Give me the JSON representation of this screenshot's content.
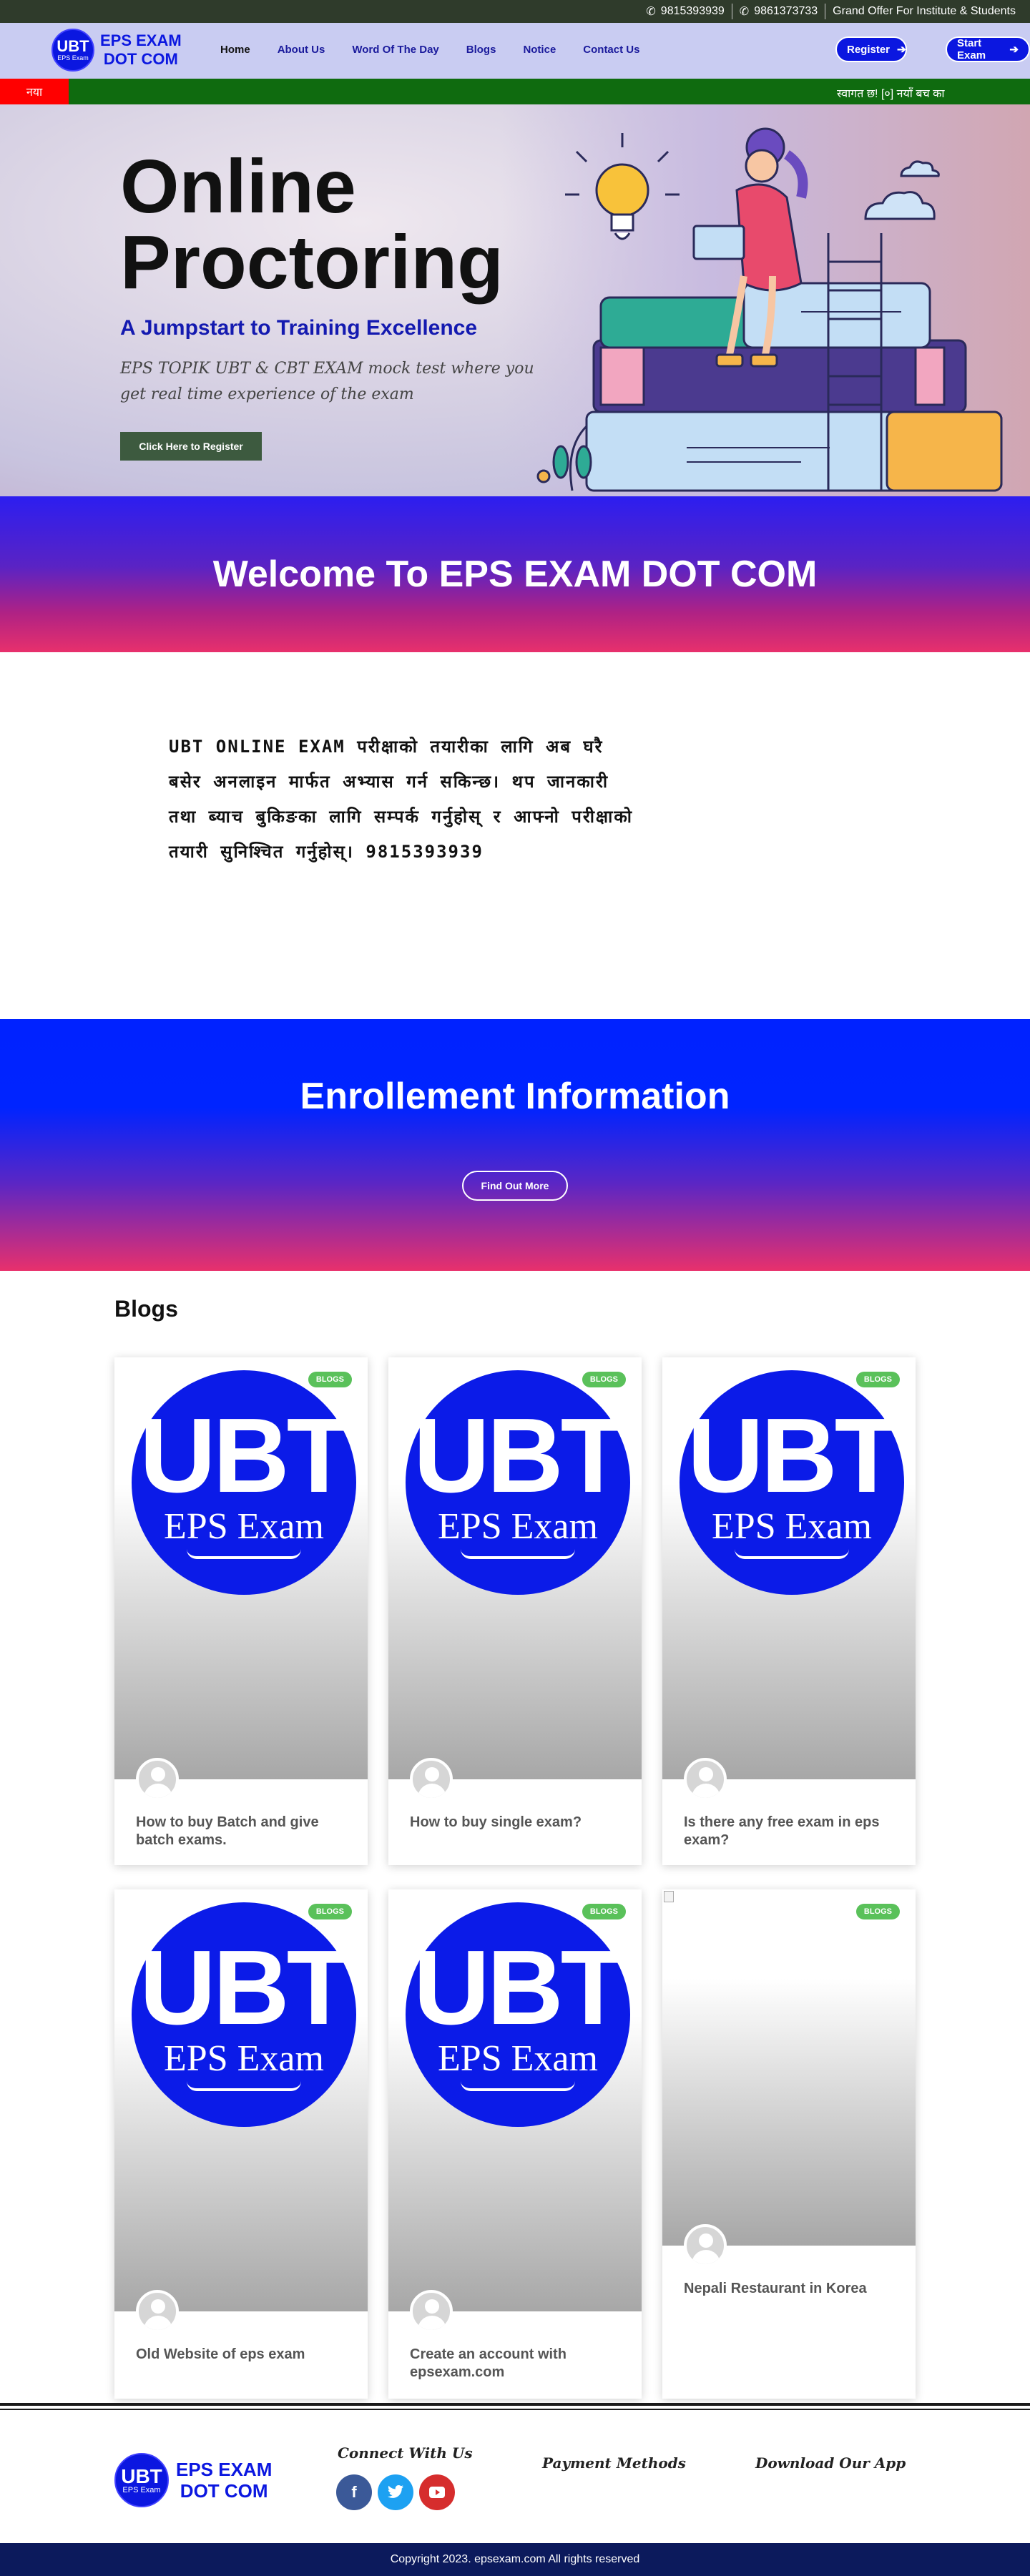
{
  "topbar": {
    "phone1": "9815393939",
    "phone2": "9861373733",
    "offer": "Grand Offer For Institute & Students"
  },
  "header": {
    "logo_circle_top": "UBT",
    "logo_circle_bottom": "EPS Exam",
    "logo_line1": "EPS EXAM",
    "logo_line2": "DOT COM",
    "nav": [
      "Home",
      "About Us",
      "Word Of The Day",
      "Blogs",
      "Notice",
      "Contact Us"
    ],
    "register_label": "Register",
    "start_exam_label": "Start Exam"
  },
  "ticker": {
    "label": "नया",
    "text": "स्वागत छ! [०] नयाँ बच का"
  },
  "hero": {
    "title_line1": "Online",
    "title_line2": "Proctoring",
    "subtitle": "A Jumpstart to Training Excellence",
    "description": "EPS TOPIK UBT & CBT EXAM mock test where you get real time experience of the exam",
    "button_label": "Click Here to Register"
  },
  "welcome": {
    "heading": "Welcome To EPS EXAM DOT COM"
  },
  "about": {
    "text": "UBT ONLINE EXAM परीक्षाको तयारीका लागि अब घरै बसेर अनलाइन मार्फत अभ्यास गर्न सकिन्छ। थप जानकारी तथा ब्याच बुकिङका लागि सम्पर्क गर्नुहोस् र आफ्नो परीक्षाको तयारी सुनिश्चित गर्नुहोस्। 9815393939"
  },
  "enroll": {
    "heading": "Enrollement Information",
    "button_label": "Find Out More"
  },
  "blogs": {
    "heading": "Blogs",
    "badge": "BLOGS",
    "thumb_top": "UBT",
    "thumb_bottom": "EPS Exam",
    "posts": [
      {
        "title": "How to buy Batch and give batch exams."
      },
      {
        "title": "How to buy single exam?"
      },
      {
        "title": "Is there any free exam in eps exam?"
      },
      {
        "title": "Old Website of eps exam"
      },
      {
        "title": "Create an account with epsexam.com"
      },
      {
        "title": "Nepali Restaurant in Korea"
      }
    ]
  },
  "footer": {
    "connect": "Connect With Us",
    "payment": "Payment Methods",
    "download": "Download Our App",
    "social": [
      "facebook-icon",
      "twitter-icon",
      "youtube-icon"
    ],
    "copyright": "Copyright 2023. epsexam.com All rights reserved"
  },
  "colors": {
    "brand_blue": "#0b17e0",
    "topbar_green": "#2f3b2b",
    "ticker_green": "#0f6b0f",
    "ticker_red": "#ff0000",
    "badge_green": "#5ac15a",
    "footer_navy": "#0c1a5c"
  }
}
